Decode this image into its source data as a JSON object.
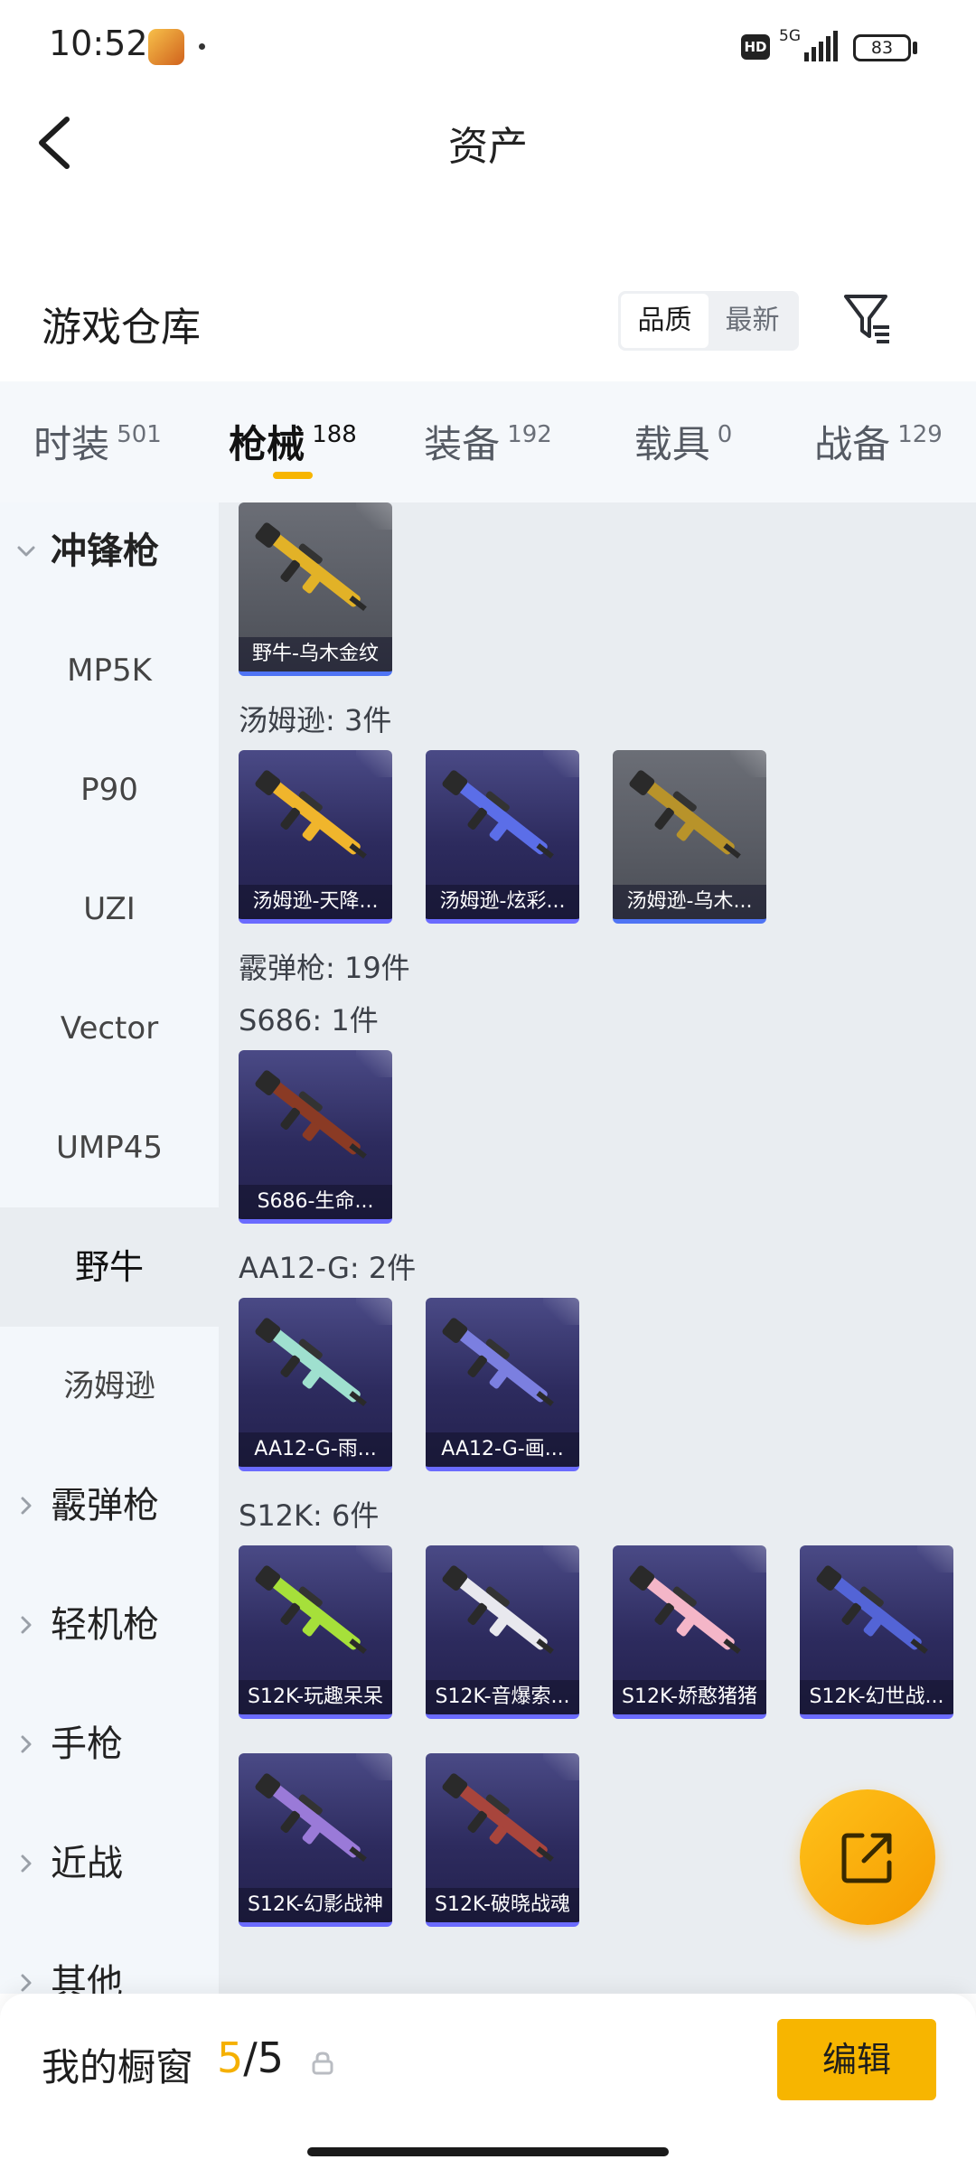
{
  "status_bar": {
    "time": "10:52",
    "network": "5G",
    "hd": "HD",
    "battery": "83"
  },
  "nav": {
    "title": "资产"
  },
  "warehouse": {
    "title": "游戏仓库",
    "sort_options": [
      "品质",
      "最新"
    ],
    "active_sort": "品质"
  },
  "tabs": [
    {
      "label": "时装",
      "count": "501",
      "active": false
    },
    {
      "label": "枪械",
      "count": "188",
      "active": true
    },
    {
      "label": "装备",
      "count": "192",
      "active": false
    },
    {
      "label": "载具",
      "count": "0",
      "active": false
    },
    {
      "label": "战备",
      "count": "129",
      "active": false
    }
  ],
  "sidebar": [
    {
      "label": "冲锋枪",
      "type": "group",
      "expanded": true
    },
    {
      "label": "MP5K",
      "type": "sub"
    },
    {
      "label": "P90",
      "type": "sub"
    },
    {
      "label": "UZI",
      "type": "sub"
    },
    {
      "label": "Vector",
      "type": "sub"
    },
    {
      "label": "UMP45",
      "type": "sub"
    },
    {
      "label": "野牛",
      "type": "sub",
      "selected": true
    },
    {
      "label": "汤姆逊",
      "type": "sub"
    },
    {
      "label": "霰弹枪",
      "type": "group",
      "expanded": false
    },
    {
      "label": "轻机枪",
      "type": "group",
      "expanded": false
    },
    {
      "label": "手枪",
      "type": "group",
      "expanded": false
    },
    {
      "label": "近战",
      "type": "group",
      "expanded": false
    },
    {
      "label": "其他",
      "type": "group",
      "expanded": false
    }
  ],
  "content": {
    "sections": [
      {
        "title": "",
        "items": [
          {
            "name": "野牛-乌木金纹",
            "style": "gold",
            "color": "#e2b227"
          }
        ]
      },
      {
        "title": "汤姆逊: 3件",
        "items": [
          {
            "name": "汤姆逊-天降...",
            "style": "purple",
            "color": "#f0b52c"
          },
          {
            "name": "汤姆逊-炫彩...",
            "style": "purple",
            "color": "#5b6ee8"
          },
          {
            "name": "汤姆逊-乌木...",
            "style": "gold",
            "color": "#b8932a"
          }
        ]
      },
      {
        "title": "霰弹枪: 19件",
        "items": []
      },
      {
        "title": "S686: 1件",
        "items": [
          {
            "name": "S686-生命...",
            "style": "purple",
            "color": "#8a3a24"
          }
        ]
      },
      {
        "title": "AA12-G: 2件",
        "items": [
          {
            "name": "AA12-G-雨...",
            "style": "purple",
            "color": "#9fe0cf"
          },
          {
            "name": "AA12-G-画...",
            "style": "purple",
            "color": "#7b7fe0"
          }
        ]
      },
      {
        "title": "S12K: 6件",
        "items": [
          {
            "name": "S12K-玩趣呆呆",
            "style": "purple",
            "color": "#a6e03a"
          },
          {
            "name": "S12K-音爆索...",
            "style": "purple",
            "color": "#e8e8ee"
          },
          {
            "name": "S12K-娇憨猪猪",
            "style": "purple",
            "color": "#f4b6c8"
          },
          {
            "name": "S12K-幻世战...",
            "style": "purple",
            "color": "#5364d6"
          },
          {
            "name": "S12K-幻影战神",
            "style": "purple",
            "color": "#9a7ad8"
          },
          {
            "name": "S12K-破晓战魂",
            "style": "purple",
            "color": "#a8453c"
          }
        ]
      }
    ]
  },
  "bottom_bar": {
    "title": "我的橱窗",
    "count_current": "5",
    "count_sep": "/",
    "count_total": "5",
    "edit_label": "编辑"
  }
}
